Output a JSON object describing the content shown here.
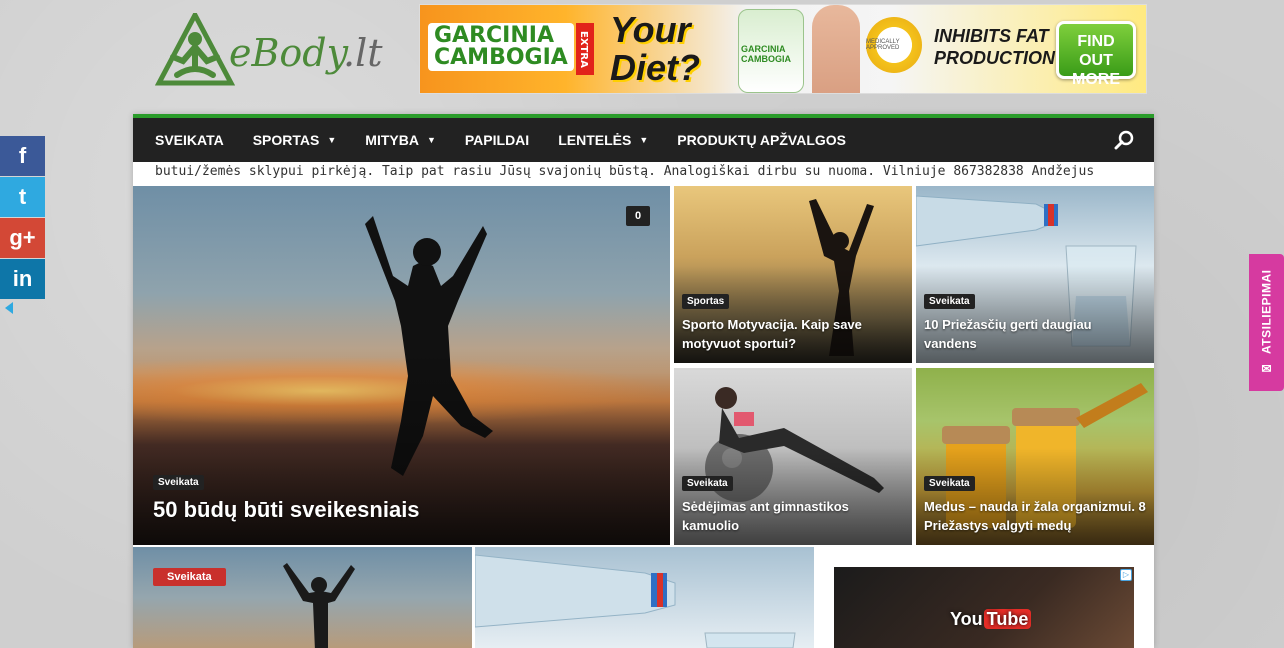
{
  "logo": {
    "text_main": "eBody",
    "text_suffix": ".lt"
  },
  "banner": {
    "brand_line1": "GARCINIA",
    "brand_line2": "CAMBOGIA",
    "brand_extra": "EXTRA",
    "headline1": "Your",
    "headline2": "Diet?",
    "bottle_label": "GARCINIA CAMBOGIA",
    "seal_text": "MEDICALLY APPROVED",
    "claim1": "INHIBITS FAT",
    "claim2": "PRODUCTION",
    "cta": "FIND OUT MORE"
  },
  "nav": {
    "items": [
      {
        "label": "SVEIKATA",
        "dropdown": false
      },
      {
        "label": "SPORTAS",
        "dropdown": true
      },
      {
        "label": "MITYBA",
        "dropdown": true
      },
      {
        "label": "PAPILDAI",
        "dropdown": false
      },
      {
        "label": "LENTELĖS",
        "dropdown": true
      },
      {
        "label": "PRODUKTŲ APŽVALGOS",
        "dropdown": false
      }
    ],
    "accent": "#2a9c2a"
  },
  "ticker": {
    "text": "butui/žemės sklypui pirkėją. Taip pat rasiu Jūsų svajonių būstą. Analogiškai dirbu su nuoma. Vilniuje 867382838 Andžejus"
  },
  "featured": {
    "big": {
      "category": "Sveikata",
      "title": "50 būdų būti sveikesniais",
      "comments": "0"
    },
    "tiles": [
      {
        "category": "Sportas",
        "title": "Sporto Motyvacija. Kaip save motyvuot sportui?"
      },
      {
        "category": "Sveikata",
        "title": "10 Priežasčių gerti daugiau vandens"
      },
      {
        "category": "Sveikata",
        "title": "Sėdėjimas ant gimnastikos kamuolio"
      },
      {
        "category": "Sveikata",
        "title": "Medus – nauda ir žala organizmui. 8 Priežastys valgyti medų"
      }
    ]
  },
  "row2": {
    "category": "Sveikata"
  },
  "ad2": {
    "youtube_you": "You",
    "youtube_tube": "Tube"
  },
  "social": {
    "facebook": "f",
    "twitter": "t",
    "googleplus": "g+",
    "linkedin": "in"
  },
  "feedback": {
    "label": "ATSILIEPIMAI"
  }
}
